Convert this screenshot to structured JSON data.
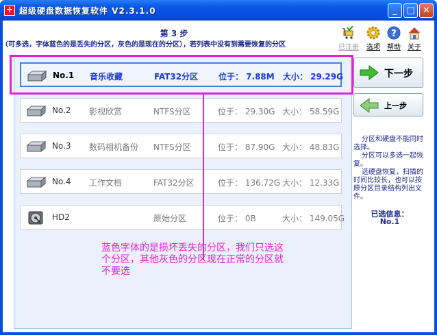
{
  "window": {
    "title": "超级硬盘数据恢复软件  V2.3.1.0",
    "minimize": "_",
    "maximize": "□",
    "close": "✕",
    "app_icon_glyph": "+"
  },
  "header": {
    "step_title": "第 3 步",
    "hint": "（可多选，字体蓝色的是丢失的分区，灰色的是现在的分区），若列表中没有到需要恢复的分区"
  },
  "toolbar": {
    "registered": "已注册",
    "options": "选项",
    "help": "帮助",
    "about": "关于"
  },
  "partitions": [
    {
      "num": "No.1",
      "name": "音乐收藏",
      "fs": "FAT32分区",
      "pos": "位于： 7.88M",
      "size": "大小：  29.29G",
      "selected": true
    },
    {
      "num": "No.2",
      "name": "影视欣赏",
      "fs": "NTFS分区",
      "pos": "位于： 29.30G",
      "size": "大小：  58.59G",
      "selected": false
    },
    {
      "num": "No.3",
      "name": "数码相机备份",
      "fs": "NTFS分区",
      "pos": "位于： 87.90G",
      "size": "大小：  48.83G",
      "selected": false
    },
    {
      "num": "No.4",
      "name": "工作文档",
      "fs": "FAT32分区",
      "pos": "位于： 136.72G",
      "size": "大小：  12.33G",
      "selected": false
    },
    {
      "num": "HD2",
      "name": "",
      "fs": "原始分区",
      "pos": "位于： 0B",
      "size": "大小：  149.05G",
      "selected": false
    }
  ],
  "annotation": "蓝色字体的是损坏丢失的分区，我们只选这个分区，其他灰色的分区现在正常的分区就不要选",
  "nav": {
    "next": "下一步",
    "prev": "上一步"
  },
  "side_notes": [
    "分区和硬盘不能同时选择。",
    "分区可以多选一起恢复。",
    "选硬盘恢复，扫描的时间比较长，也可以按原分区目录结构列出文件。"
  ],
  "selected_info": {
    "label": "已选信息：",
    "value": "No.1"
  },
  "colors": {
    "lost_partition": "#1a3ad0",
    "current_partition": "#7a7a7a",
    "annotation": "#e41fd6",
    "titlebar": "#0550de"
  }
}
